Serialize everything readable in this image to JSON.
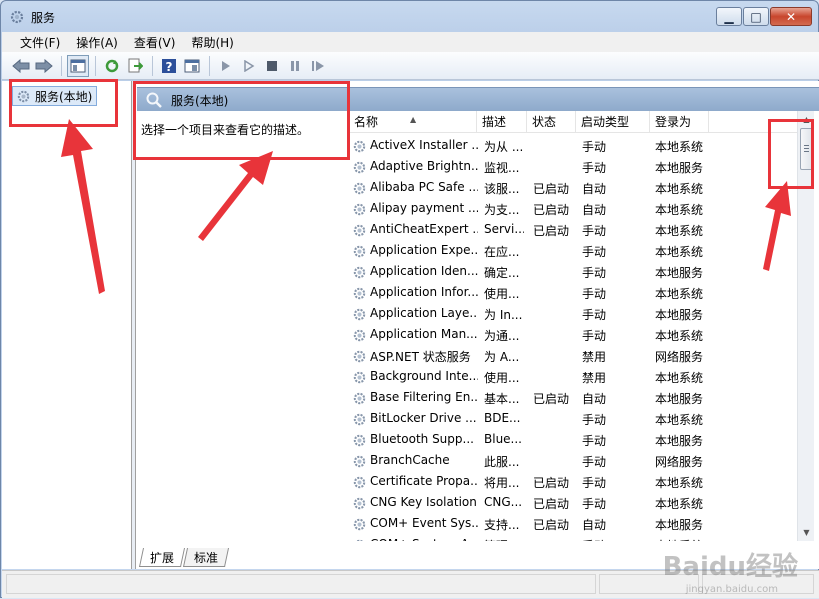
{
  "window": {
    "title": "服务"
  },
  "menu": {
    "items": [
      "文件(F)",
      "操作(A)",
      "查看(V)",
      "帮助(H)"
    ]
  },
  "tree": {
    "root_label": "服务(本地)"
  },
  "pane": {
    "header": "服务(本地)",
    "description": "选择一个项目来查看它的描述。"
  },
  "table": {
    "columns": [
      "名称",
      "描述",
      "状态",
      "启动类型",
      "登录为"
    ],
    "rows": [
      [
        "ActiveX Installer ...",
        "为从 ...",
        "",
        "手动",
        "本地系统"
      ],
      [
        "Adaptive Brightn...",
        "监视...",
        "",
        "手动",
        "本地服务"
      ],
      [
        "Alibaba PC Safe ...",
        "该服...",
        "已启动",
        "自动",
        "本地系统"
      ],
      [
        "Alipay payment ...",
        "为支...",
        "已启动",
        "自动",
        "本地系统"
      ],
      [
        "AntiCheatExpert ...",
        "Servi...",
        "已启动",
        "手动",
        "本地系统"
      ],
      [
        "Application Expe...",
        "在应...",
        "",
        "手动",
        "本地系统"
      ],
      [
        "Application Iden...",
        "确定...",
        "",
        "手动",
        "本地服务"
      ],
      [
        "Application Infor...",
        "使用...",
        "",
        "手动",
        "本地系统"
      ],
      [
        "Application Laye...",
        "为 In...",
        "",
        "手动",
        "本地服务"
      ],
      [
        "Application Man...",
        "为通...",
        "",
        "手动",
        "本地系统"
      ],
      [
        "ASP.NET 状态服务",
        "为 A...",
        "",
        "禁用",
        "网络服务"
      ],
      [
        "Background Inte...",
        "使用...",
        "",
        "禁用",
        "本地系统"
      ],
      [
        "Base Filtering En...",
        "基本...",
        "已启动",
        "自动",
        "本地服务"
      ],
      [
        "BitLocker Drive ...",
        "BDE...",
        "",
        "手动",
        "本地系统"
      ],
      [
        "Bluetooth Supp...",
        "Blue...",
        "",
        "手动",
        "本地服务"
      ],
      [
        "BranchCache",
        "此服...",
        "",
        "手动",
        "网络服务"
      ],
      [
        "Certificate Propa...",
        "将用...",
        "已启动",
        "手动",
        "本地系统"
      ],
      [
        "CNG Key Isolation",
        "CNG...",
        "已启动",
        "手动",
        "本地系统"
      ],
      [
        "COM+ Event Sys...",
        "支持...",
        "已启动",
        "自动",
        "本地服务"
      ],
      [
        "COM+ System A...",
        "管理...",
        "",
        "手动",
        "本地系统"
      ]
    ]
  },
  "tabs": [
    "扩展",
    "标准"
  ],
  "watermark": {
    "text": "Baidu经验",
    "sub": "jingyan.baidu.com"
  },
  "colors": {
    "annotation": "#e8343a",
    "header_bar": "#9fb8d6"
  },
  "icons": [
    "back-icon",
    "forward-icon",
    "console-tree-icon",
    "refresh-icon",
    "export-icon",
    "help-icon",
    "properties-icon",
    "play-icon",
    "start-icon",
    "stop-icon",
    "pause-icon",
    "resume-icon",
    "gear-icon"
  ]
}
